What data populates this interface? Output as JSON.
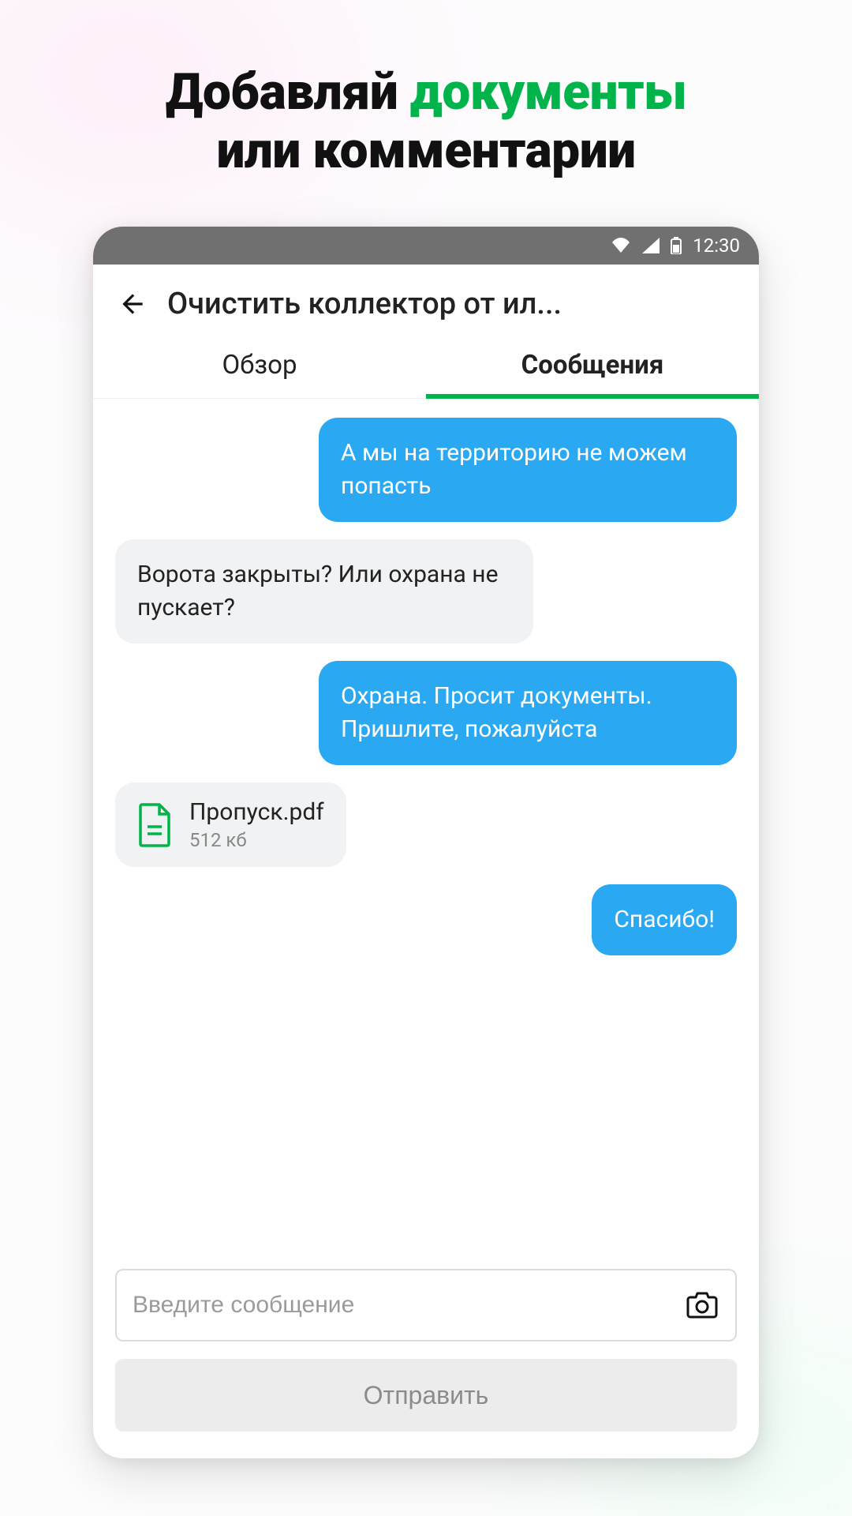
{
  "promo": {
    "line1_part1": "Добавляй ",
    "line1_accent": "документы",
    "line2": "или комментарии"
  },
  "status_bar": {
    "time": "12:30"
  },
  "header": {
    "title": "Очистить коллектор от ил..."
  },
  "tabs": {
    "overview": "Обзор",
    "messages": "Сообщения"
  },
  "messages": {
    "m0": "А мы на территорию не можем попасть",
    "m1": "Ворота закрыты? Или охрана не пускает?",
    "m2": "Охрана. Просит документы. Пришлите, пожалуйста",
    "m3_file_name": "Пропуск.pdf",
    "m3_file_size": "512 кб",
    "m4": "Спасибо!"
  },
  "compose": {
    "placeholder": "Введите сообщение",
    "send_label": "Отправить"
  },
  "colors": {
    "accent_green": "#00b34a",
    "bubble_sent": "#2aa8f2",
    "bubble_recv": "#f1f2f3"
  }
}
